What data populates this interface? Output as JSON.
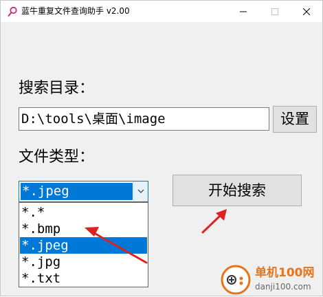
{
  "window": {
    "title": "蓝牛重复文件查询助手 v2.00"
  },
  "titlebar_icons": {
    "app": "magnifier-icon",
    "minimize": "minimize-icon",
    "maximize": "maximize-icon",
    "close": "close-icon"
  },
  "form": {
    "directory_label": "搜索目录：",
    "directory_value": "D:\\tools\\桌面\\image",
    "settings_button": "设置",
    "filetype_label": "文件类型：",
    "search_button": "开始搜索"
  },
  "filetype_combo": {
    "selected": "*.jpeg",
    "options": [
      {
        "label": "*.*",
        "highlighted": false
      },
      {
        "label": "*.bmp",
        "highlighted": false
      },
      {
        "label": "*.jpeg",
        "highlighted": true
      },
      {
        "label": "*.jpg",
        "highlighted": false
      },
      {
        "label": "*.txt",
        "highlighted": false
      }
    ]
  },
  "annotation": {
    "arrow_color": "#e02020"
  },
  "watermark": {
    "name": "单机100网",
    "url": "danji100.com"
  },
  "colors": {
    "accent": "#0078d7",
    "watermark_orange": "#e8731a"
  }
}
